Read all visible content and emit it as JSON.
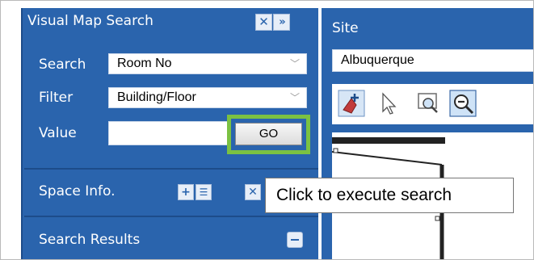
{
  "panel": {
    "title": "Visual Map Search",
    "close_glyph": "✕",
    "expand_glyph": "»",
    "search_label": "Search",
    "search_value": "Room No",
    "filter_label": "Filter",
    "filter_value": "Building/Floor",
    "value_label": "Value",
    "value_input": "",
    "go_label": "GO",
    "space_info_label": "Space Info.",
    "space_add_glyph": "+",
    "space_list_glyph": "☰",
    "space_close_glyph": "✕",
    "search_results_label": "Search Results"
  },
  "site": {
    "label": "Site",
    "value": "Albuquerque"
  },
  "toolbar": {
    "tools": [
      "map-marker-icon",
      "pointer-icon",
      "zoom-window-icon",
      "zoom-out-icon"
    ]
  },
  "tooltip": {
    "text": "Click to execute search"
  },
  "colors": {
    "panel_blue": "#2a64ad",
    "highlight_green": "#7bc142"
  }
}
